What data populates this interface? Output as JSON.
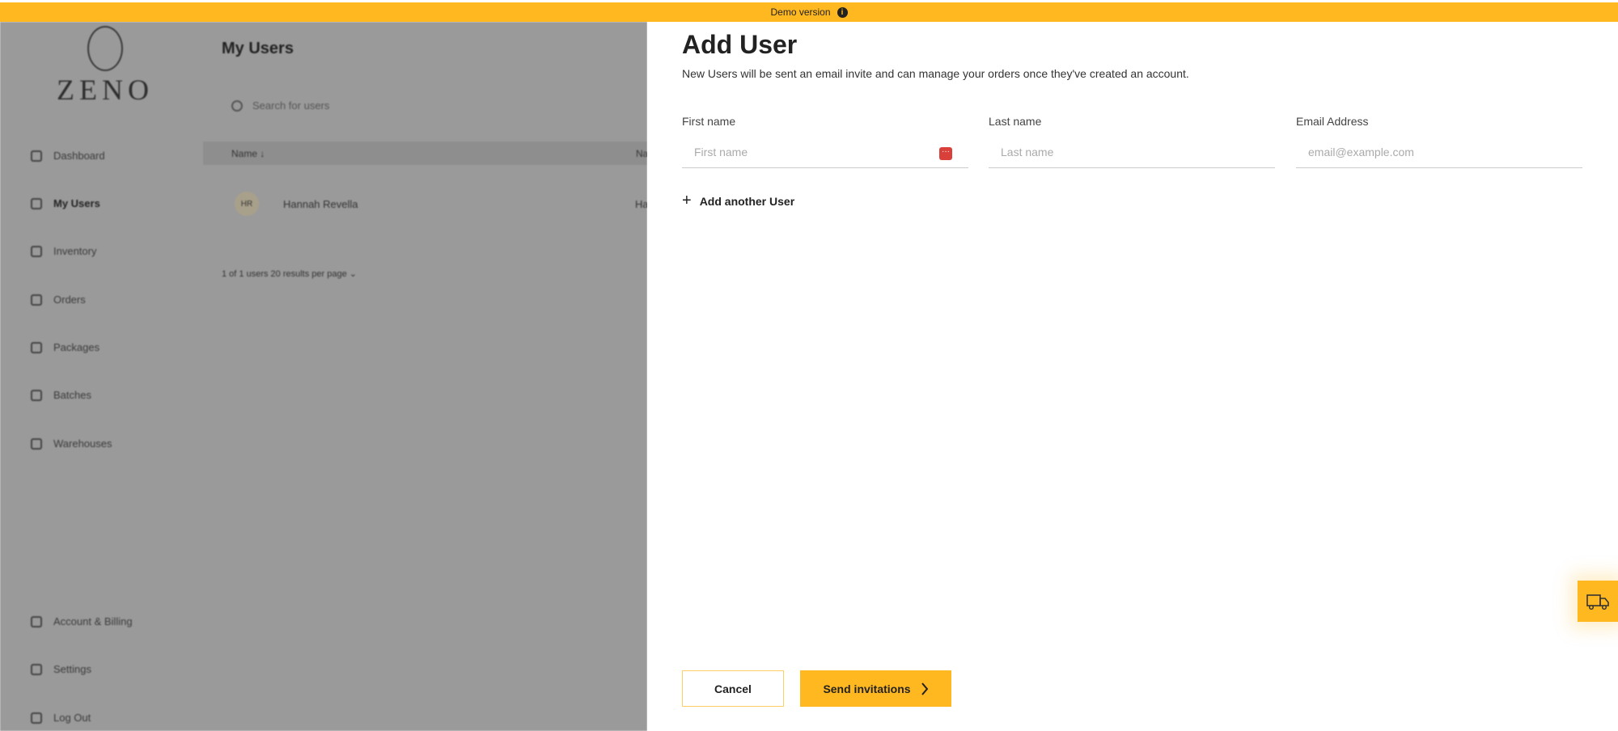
{
  "banner": {
    "text": "Demo version",
    "icon": "info-icon"
  },
  "background": {
    "logo": "ZENO",
    "nav": [
      {
        "label": "Dashboard",
        "icon": "chart-icon"
      },
      {
        "label": "My Users",
        "icon": "user-icon",
        "active": true
      },
      {
        "label": "Inventory",
        "icon": "box-icon"
      },
      {
        "label": "Orders",
        "icon": "location-icon"
      },
      {
        "label": "Packages",
        "icon": "package-icon"
      },
      {
        "label": "Batches",
        "icon": "batch-icon"
      },
      {
        "label": "Warehouses",
        "icon": "warehouse-icon"
      },
      {
        "label": "Account & Billing",
        "icon": "account-icon"
      },
      {
        "label": "Settings",
        "icon": "gear-icon"
      },
      {
        "label": "Log Out",
        "icon": "logout-icon"
      }
    ],
    "title": "My Users",
    "search_placeholder": "Search for users",
    "table": {
      "columns": [
        "Name ↓",
        "Na"
      ],
      "rows": [
        {
          "initials": "HR",
          "name": "Hannah Revella",
          "col2": "Ha"
        }
      ]
    },
    "pagination": "1 of 1 users   20 results per page ⌄"
  },
  "modal": {
    "title": "Add User",
    "subtitle": "New Users will be sent an email invite and can manage your orders once they've created an account.",
    "fields": [
      {
        "label": "First name",
        "placeholder": "First name",
        "value": ""
      },
      {
        "label": "Last name",
        "placeholder": "Last name",
        "value": ""
      },
      {
        "label": "Email Address",
        "placeholder": "email@example.com",
        "value": ""
      }
    ],
    "add_another": "Add another User",
    "cancel": "Cancel",
    "send": "Send invitations"
  },
  "colors": {
    "accent": "#FFB81F",
    "overlay": "#9a9a9a"
  }
}
